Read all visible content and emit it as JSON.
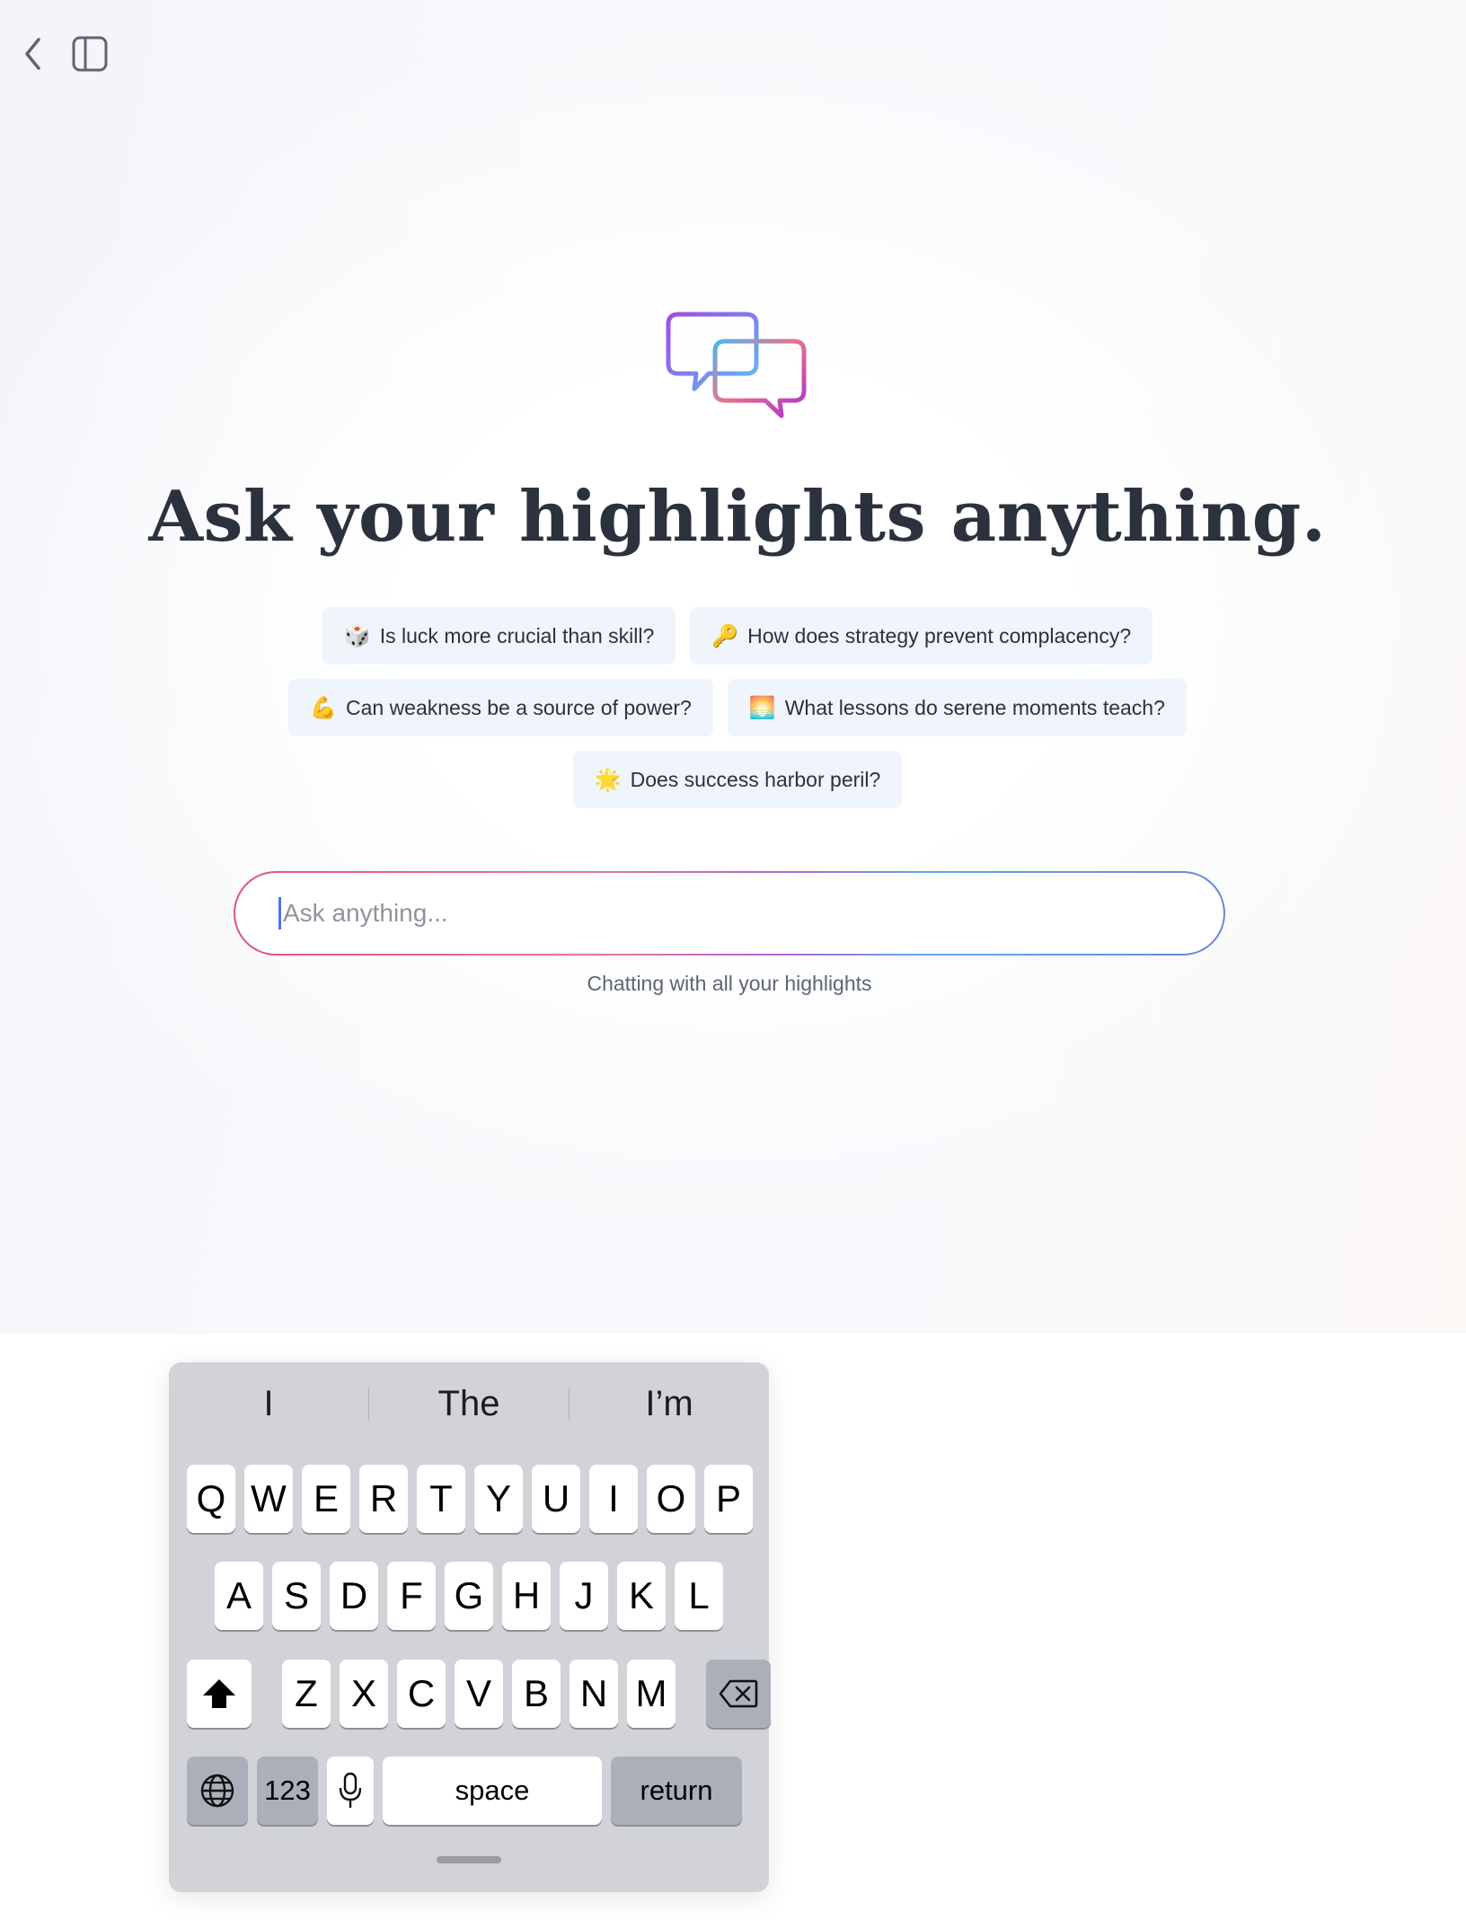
{
  "toolbar": {
    "back_icon": "chevron-left-icon",
    "sidebar_icon": "sidebar-panel-icon"
  },
  "logo": {
    "icon": "chat-bubbles-icon"
  },
  "headline": "Ask your highlights anything.",
  "suggestions": [
    {
      "emoji": "🎲",
      "label": "Is luck more crucial than skill?"
    },
    {
      "emoji": "🔑",
      "label": "How does strategy prevent complacency?"
    },
    {
      "emoji": "💪",
      "label": "Can weakness be a source of power?"
    },
    {
      "emoji": "🌅",
      "label": "What lessons do serene moments teach?"
    },
    {
      "emoji": "🌟",
      "label": "Does success harbor peril?"
    }
  ],
  "chat_input": {
    "placeholder": "Ask anything...",
    "value": ""
  },
  "caption": "Chatting with all your highlights",
  "keyboard": {
    "predictions": [
      "I",
      "The",
      "I’m"
    ],
    "row1": [
      "Q",
      "W",
      "E",
      "R",
      "T",
      "Y",
      "U",
      "I",
      "O",
      "P"
    ],
    "row2": [
      "A",
      "S",
      "D",
      "F",
      "G",
      "H",
      "J",
      "K",
      "L"
    ],
    "row3": [
      "Z",
      "X",
      "C",
      "V",
      "B",
      "N",
      "M"
    ],
    "shift_icon": "shift-arrow-icon",
    "delete_icon": "backspace-icon",
    "globe_icon": "globe-icon",
    "numbers_label": "123",
    "mic_icon": "microphone-icon",
    "space_label": "space",
    "return_label": "return"
  }
}
